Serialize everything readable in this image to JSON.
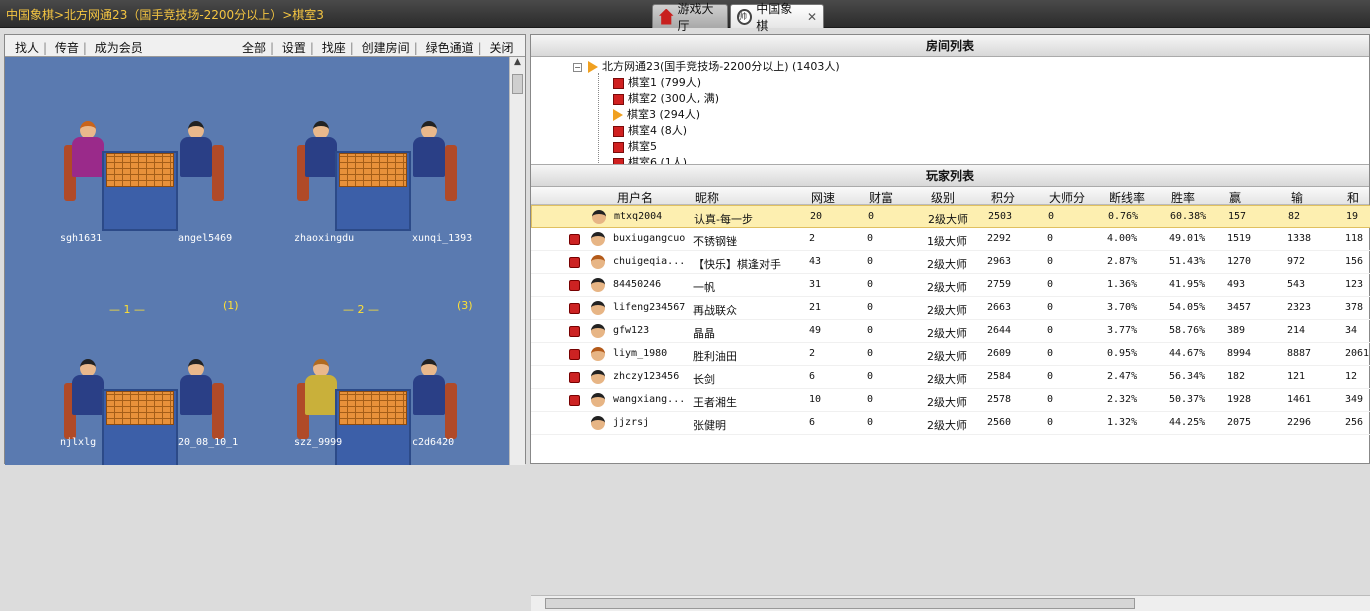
{
  "breadcrumb": "中国象棋>北方网通23（国手竞技场-2200分以上）>棋室3",
  "tabs": [
    {
      "label": "游戏大厅",
      "icon": "home-icon"
    },
    {
      "label": "中国象棋",
      "icon": "chess-piece-icon"
    }
  ],
  "left_toolbar": {
    "left_links": [
      "找人",
      "传音",
      "成为会员"
    ],
    "right_links": [
      "全部",
      "设置",
      "找座",
      "创建房间",
      "绿色通道",
      "关闭"
    ]
  },
  "tables": [
    {
      "number": "1",
      "count": "(1)",
      "players": [
        "sgh1631",
        "angel5469"
      ]
    },
    {
      "number": "2",
      "count": "(3)",
      "players": [
        "zhaoxingdu",
        "xunqi_1393"
      ]
    },
    {
      "players": [
        "njlxlg",
        "20_08_10_1"
      ]
    },
    {
      "players": [
        "szz_9999",
        "c2d6420"
      ]
    }
  ],
  "room_list": {
    "title": "房间列表",
    "server": "北方网通23(国手竞技场-2200分以上) (1403人)",
    "rooms": [
      {
        "label": "棋室1 (799人)",
        "icon": "room-cube-icon"
      },
      {
        "label": "棋室2 (300人, 满)",
        "icon": "room-cube-icon"
      },
      {
        "label": "棋室3 (294人)",
        "icon": "current-room-arrow-icon"
      },
      {
        "label": "棋室4 (8人)",
        "icon": "room-cube-icon"
      },
      {
        "label": "棋室5",
        "icon": "room-cube-icon"
      },
      {
        "label": "棋室6 (1人)",
        "icon": "room-cube-icon"
      }
    ]
  },
  "player_list": {
    "title": "玩家列表",
    "columns": [
      "用户名",
      "昵称",
      "网速",
      "财富",
      "级别",
      "积分",
      "大师分",
      "断线率",
      "胜率",
      "赢",
      "输",
      "和"
    ],
    "rows": [
      {
        "username": "mtxq2004",
        "nickname": "认真-每一步",
        "speed": "20",
        "wealth": "0",
        "level": "2级大师",
        "score": "2503",
        "master": "0",
        "drop": "0.76%",
        "winrate": "60.38%",
        "win": "157",
        "lose": "82",
        "draw": "19",
        "selected": true,
        "flag": false,
        "avatar": "male"
      },
      {
        "username": "buxiugangcuo",
        "nickname": "不锈钢锉",
        "speed": "2",
        "wealth": "0",
        "level": "1级大师",
        "score": "2292",
        "master": "0",
        "drop": "4.00%",
        "winrate": "49.01%",
        "win": "1519",
        "lose": "1338",
        "draw": "118",
        "flag": true,
        "avatar": "male"
      },
      {
        "username": "chuigeqia...",
        "nickname": "【快乐】棋逢对手",
        "speed": "43",
        "wealth": "0",
        "level": "2级大师",
        "score": "2963",
        "master": "0",
        "drop": "2.87%",
        "winrate": "51.43%",
        "win": "1270",
        "lose": "972",
        "draw": "156",
        "flag": true,
        "avatar": "female"
      },
      {
        "username": "84450246",
        "nickname": "一帆",
        "speed": "31",
        "wealth": "0",
        "level": "2级大师",
        "score": "2759",
        "master": "0",
        "drop": "1.36%",
        "winrate": "41.95%",
        "win": "493",
        "lose": "543",
        "draw": "123",
        "flag": true,
        "avatar": "male"
      },
      {
        "username": "lifeng234567",
        "nickname": "再战联众",
        "speed": "21",
        "wealth": "0",
        "level": "2级大师",
        "score": "2663",
        "master": "0",
        "drop": "3.70%",
        "winrate": "54.05%",
        "win": "3457",
        "lose": "2323",
        "draw": "378",
        "flag": true,
        "avatar": "male"
      },
      {
        "username": "gfw123",
        "nickname": "晶晶",
        "speed": "49",
        "wealth": "0",
        "level": "2级大师",
        "score": "2644",
        "master": "0",
        "drop": "3.77%",
        "winrate": "58.76%",
        "win": "389",
        "lose": "214",
        "draw": "34",
        "flag": true,
        "avatar": "male"
      },
      {
        "username": "liym_1980",
        "nickname": "胜利油田",
        "speed": "2",
        "wealth": "0",
        "level": "2级大师",
        "score": "2609",
        "master": "0",
        "drop": "0.95%",
        "winrate": "44.67%",
        "win": "8994",
        "lose": "8887",
        "draw": "2061",
        "flag": true,
        "avatar": "female"
      },
      {
        "username": "zhczy123456",
        "nickname": "长剑",
        "speed": "6",
        "wealth": "0",
        "level": "2级大师",
        "score": "2584",
        "master": "0",
        "drop": "2.47%",
        "winrate": "56.34%",
        "win": "182",
        "lose": "121",
        "draw": "12",
        "flag": true,
        "avatar": "male"
      },
      {
        "username": "wangxiang...",
        "nickname": "王者湘生",
        "speed": "10",
        "wealth": "0",
        "level": "2级大师",
        "score": "2578",
        "master": "0",
        "drop": "2.32%",
        "winrate": "50.37%",
        "win": "1928",
        "lose": "1461",
        "draw": "349",
        "flag": true,
        "avatar": "male"
      },
      {
        "username": "jjzrsj",
        "nickname": "张健明",
        "speed": "6",
        "wealth": "0",
        "level": "2级大师",
        "score": "2560",
        "master": "0",
        "drop": "1.32%",
        "winrate": "44.25%",
        "win": "2075",
        "lose": "2296",
        "draw": "256",
        "flag": false,
        "avatar": "male"
      }
    ]
  },
  "colors": {
    "breadcrumb": "#f4c542",
    "hall_background": "#5a7ab0",
    "selected_row": "#fdefb0",
    "table_number": "#ffe033"
  }
}
